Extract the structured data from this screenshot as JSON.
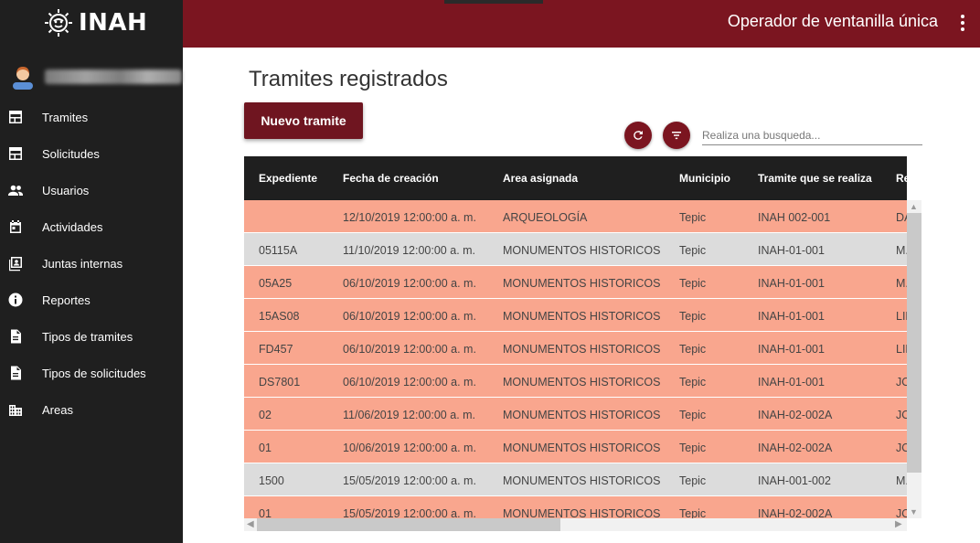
{
  "brand": {
    "name": "INAH"
  },
  "user": {
    "name": ""
  },
  "sidebar": {
    "items": [
      {
        "label": "Tramites",
        "icon": "table-icon"
      },
      {
        "label": "Solicitudes",
        "icon": "table-icon"
      },
      {
        "label": "Usuarios",
        "icon": "people-icon"
      },
      {
        "label": "Actividades",
        "icon": "calendar-icon"
      },
      {
        "label": "Juntas internas",
        "icon": "contacts-icon"
      },
      {
        "label": "Reportes",
        "icon": "info-icon"
      },
      {
        "label": "Tipos de tramites",
        "icon": "document-icon"
      },
      {
        "label": "Tipos de solicitudes",
        "icon": "document-icon"
      },
      {
        "label": "Areas",
        "icon": "buildings-icon"
      }
    ]
  },
  "header": {
    "role": "Operador de ventanilla única"
  },
  "main": {
    "title": "Tramites registrados",
    "new_button": "Nuevo tramite",
    "search_placeholder": "Realiza una busqueda..."
  },
  "table": {
    "columns": [
      "Expediente",
      "Fecha de creación",
      "Area asignada",
      "Municipio",
      "Tramite que se realiza",
      "Re"
    ],
    "rows": [
      {
        "color": "salmon",
        "cells": [
          "",
          "12/10/2019 12:00:00 a. m.",
          "ARQUEOLOGÍA",
          "Tepic",
          "INAH 002-001",
          "DA"
        ]
      },
      {
        "color": "gray",
        "cells": [
          "05115A",
          "11/10/2019 12:00:00 a. m.",
          "MONUMENTOS HISTORICOS",
          "Tepic",
          "INAH-01-001",
          "M."
        ]
      },
      {
        "color": "salmon",
        "cells": [
          "05A25",
          "06/10/2019 12:00:00 a. m.",
          "MONUMENTOS HISTORICOS",
          "Tepic",
          "INAH-01-001",
          "M."
        ]
      },
      {
        "color": "salmon",
        "cells": [
          "15AS08",
          "06/10/2019 12:00:00 a. m.",
          "MONUMENTOS HISTORICOS",
          "Tepic",
          "INAH-01-001",
          "LIL"
        ]
      },
      {
        "color": "salmon",
        "cells": [
          "FD457",
          "06/10/2019 12:00:00 a. m.",
          "MONUMENTOS HISTORICOS",
          "Tepic",
          "INAH-01-001",
          "LIL"
        ]
      },
      {
        "color": "salmon",
        "cells": [
          "DS7801",
          "06/10/2019 12:00:00 a. m.",
          "MONUMENTOS HISTORICOS",
          "Tepic",
          "INAH-01-001",
          "JO"
        ]
      },
      {
        "color": "salmon",
        "cells": [
          "02",
          "11/06/2019 12:00:00 a. m.",
          "MONUMENTOS HISTORICOS",
          "Tepic",
          "INAH-02-002A",
          "JO"
        ]
      },
      {
        "color": "salmon",
        "cells": [
          "01",
          "10/06/2019 12:00:00 a. m.",
          "MONUMENTOS HISTORICOS",
          "Tepic",
          "INAH-02-002A",
          "JO"
        ]
      },
      {
        "color": "gray",
        "cells": [
          "1500",
          "15/05/2019 12:00:00 a. m.",
          "MONUMENTOS HISTORICOS",
          "Tepic",
          "INAH-001-002",
          "M."
        ]
      },
      {
        "color": "salmon",
        "cells": [
          "01",
          "15/05/2019 12:00:00 a. m.",
          "MONUMENTOS HISTORICOS",
          "Tepic",
          "INAH-02-002A",
          "JO"
        ]
      }
    ]
  },
  "colors": {
    "accent": "#7b1520",
    "sidebar": "#1f1f1f",
    "row_salmon": "#f9a68e",
    "row_gray": "#dcdcdc"
  }
}
